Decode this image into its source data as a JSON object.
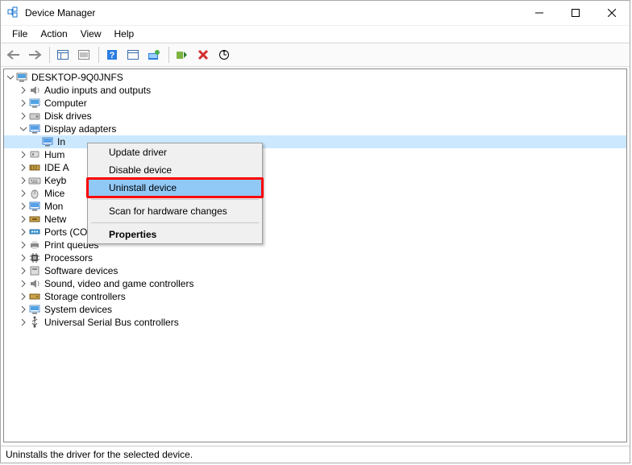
{
  "window": {
    "title": "Device Manager"
  },
  "menu": {
    "file": "File",
    "action": "Action",
    "view": "View",
    "help": "Help"
  },
  "tree": {
    "root": "DESKTOP-9Q0JNFS",
    "items": [
      "Audio inputs and outputs",
      "Computer",
      "Disk drives",
      "Display adapters",
      "",
      "Hum",
      "IDE A",
      "Keyb",
      "Mice",
      "Mon",
      "Netw",
      "Ports (COM & LPT)",
      "Print queues",
      "Processors",
      "Software devices",
      "Sound, video and game controllers",
      "Storage controllers",
      "System devices",
      "Universal Serial Bus controllers"
    ],
    "display_child_prefix": "In"
  },
  "context_menu": {
    "update": "Update driver",
    "disable": "Disable device",
    "uninstall": "Uninstall device",
    "scan": "Scan for hardware changes",
    "properties": "Properties"
  },
  "status": "Uninstalls the driver for the selected device."
}
